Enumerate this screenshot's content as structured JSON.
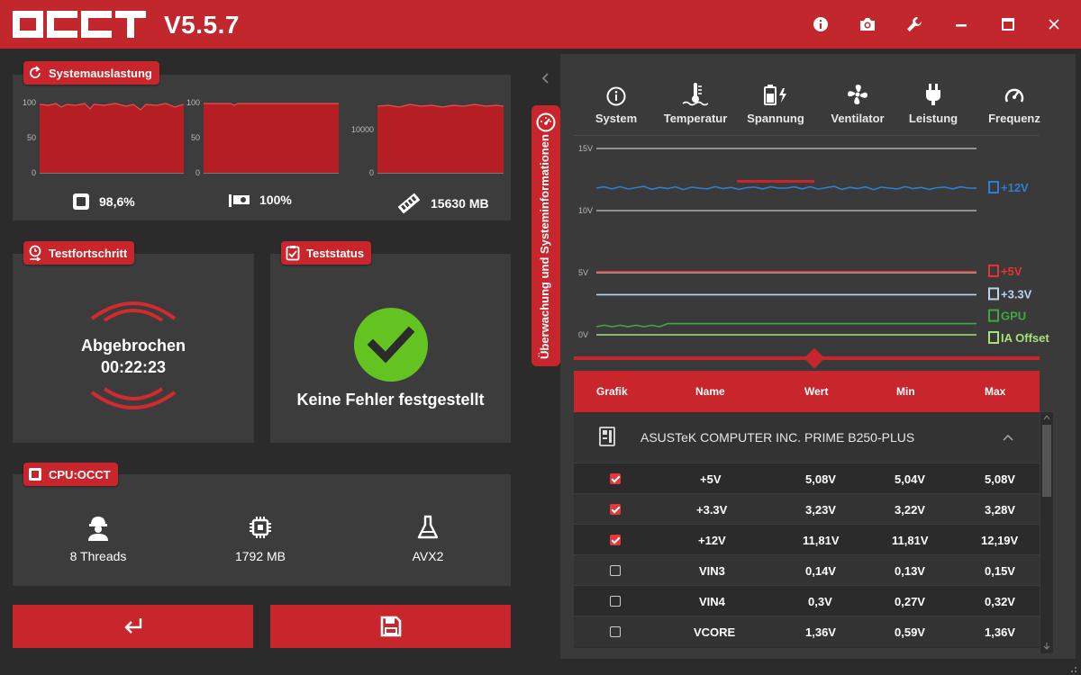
{
  "app": {
    "version": "V5.5.7"
  },
  "system_load": {
    "title": "Systemauslastung",
    "charts": [
      {
        "axis": [
          "100",
          "50",
          "0"
        ],
        "stat": "98,6%",
        "icon": "cpu-icon"
      },
      {
        "axis": [
          "100",
          "50",
          "0"
        ],
        "stat": "100%",
        "icon": "gpu-icon"
      },
      {
        "axis": [
          "10000",
          "0"
        ],
        "stat": "15630 MB",
        "icon": "memory-icon"
      }
    ]
  },
  "progress": {
    "title": "Testfortschritt",
    "status": "Abgebrochen",
    "time": "00:22:23"
  },
  "test_status": {
    "title": "Teststatus",
    "message": "Keine Fehler festgestellt"
  },
  "cpu_test": {
    "title": "CPU:OCCT",
    "items": [
      {
        "label": "8 Threads",
        "icon": "worker-icon"
      },
      {
        "label": "1792 MB",
        "icon": "chip-icon"
      },
      {
        "label": "AVX2",
        "icon": "flask-icon"
      }
    ]
  },
  "side_tab": {
    "label": "Überwachung und Systeminformationen"
  },
  "monitor": {
    "tabs": [
      {
        "label": "System",
        "icon": "info-icon"
      },
      {
        "label": "Temperatur",
        "icon": "thermometer-icon"
      },
      {
        "label": "Spannung",
        "icon": "battery-bolt-icon",
        "active": true
      },
      {
        "label": "Ventilator",
        "icon": "fan-icon"
      },
      {
        "label": "Leistung",
        "icon": "plug-icon"
      },
      {
        "label": "Frequenz",
        "icon": "gauge-icon"
      }
    ],
    "chart_data": {
      "type": "line",
      "y_ticks": [
        "15V",
        "10V",
        "5V",
        "0V"
      ],
      "series": [
        {
          "name": "+12V",
          "color": "#2e7fcf",
          "value": 11.81
        },
        {
          "name": "+5V",
          "color": "#e63333",
          "value": 5.08
        },
        {
          "name": "+3.3V",
          "color": "#b8d4ee",
          "value": 3.23
        },
        {
          "name": "GPU",
          "color": "#3fa83f",
          "value": 0.9
        },
        {
          "name": "IA Offset",
          "color": "#a8e07a",
          "value": 0.0
        }
      ]
    },
    "table": {
      "headers": [
        "Grafik",
        "Name",
        "Wert",
        "Min",
        "Max"
      ],
      "group": "ASUSTeK COMPUTER INC. PRIME B250-PLUS",
      "rows": [
        {
          "checked": true,
          "name": "+5V",
          "value": "5,08V",
          "min": "5,04V",
          "max": "5,08V"
        },
        {
          "checked": true,
          "name": "+3.3V",
          "value": "3,23V",
          "min": "3,22V",
          "max": "3,28V"
        },
        {
          "checked": true,
          "name": "+12V",
          "value": "11,81V",
          "min": "11,81V",
          "max": "12,19V"
        },
        {
          "checked": false,
          "name": "VIN3",
          "value": "0,14V",
          "min": "0,13V",
          "max": "0,15V"
        },
        {
          "checked": false,
          "name": "VIN4",
          "value": "0,3V",
          "min": "0,27V",
          "max": "0,32V"
        },
        {
          "checked": false,
          "name": "VCORE",
          "value": "1,36V",
          "min": "0,59V",
          "max": "1,36V"
        }
      ]
    }
  }
}
